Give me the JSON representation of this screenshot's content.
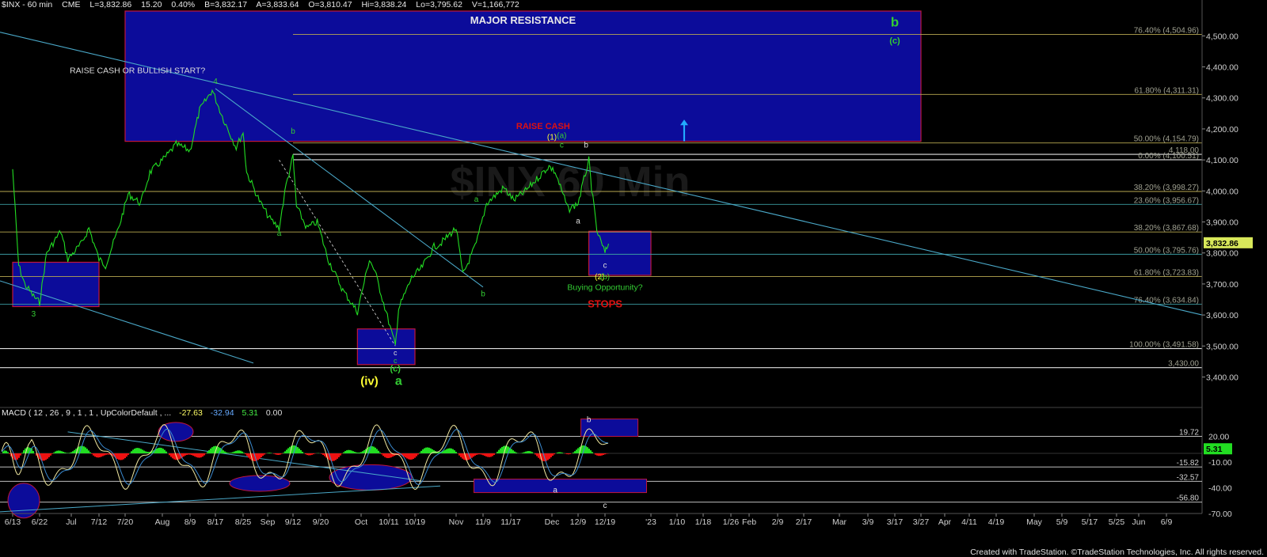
{
  "header": {
    "symbol": "$INX - 60 min",
    "exchange": "CME",
    "last": "L=3,832.86",
    "change": "15.20",
    "change_pct": "0.40%",
    "bid": "B=3,832.17",
    "ask": "A=3,833.64",
    "open": "O=3,810.47",
    "high": "Hi=3,838.24",
    "low": "Lo=3,795.62",
    "volume": "V=1,166,772"
  },
  "watermark": "$INX 60 Min",
  "colors": {
    "background": "#000000",
    "price_line": "#22dd22",
    "zone_fill": "#0c0c9a",
    "zone_border": "#c0163c",
    "trendline": "#4aa8c8",
    "fib_line": "#b8a850",
    "label_green": "#33cc33",
    "label_red": "#dd1111",
    "label_yellow": "#ffff33",
    "last_price_tag": "#d8e85a",
    "macd_up": "#22dd22",
    "macd_down": "#ee1111",
    "macd_signal": "#f0e8a0"
  },
  "chart_data": {
    "type": "line",
    "title": "",
    "y_axis": {
      "ylim": [
        3340,
        4580
      ],
      "tick_labels": [
        "4,500.00",
        "4,400.00",
        "4,300.00",
        "4,200.00",
        "4,100.00",
        "4,000.00",
        "3,900.00",
        "3,800.00",
        "3,700.00",
        "3,600.00",
        "3,500.00",
        "3,400.00"
      ],
      "tick_values": [
        4500,
        4400,
        4300,
        4200,
        4100,
        4000,
        3900,
        3800,
        3700,
        3600,
        3500,
        3400
      ]
    },
    "x_axis": {
      "tick_labels": [
        "6/13",
        "6/22",
        "Jul",
        "7/12",
        "7/20",
        "Aug",
        "8/9",
        "8/17",
        "8/25",
        "Sep",
        "9/12",
        "9/20",
        "Oct",
        "10/11",
        "10/19",
        "Nov",
        "11/9",
        "11/17",
        "Dec",
        "12/9",
        "12/19",
        "'23",
        "1/10",
        "1/18",
        "1/26",
        "Feb",
        "2/9",
        "2/17",
        "Mar",
        "3/9",
        "3/17",
        "3/27",
        "Apr",
        "4/11",
        "4/19",
        "May",
        "5/9",
        "5/17",
        "5/25",
        "Jun",
        "6/9"
      ]
    },
    "series": [
      {
        "name": "",
        "points": [
          [
            "6/13",
            4070
          ],
          [
            "6/15",
            3760
          ],
          [
            "6/17",
            3700
          ],
          [
            "6/20",
            3660
          ],
          [
            "6/22",
            3640
          ],
          [
            "6/24",
            3800
          ],
          [
            "6/28",
            3870
          ],
          [
            "6/30",
            3780
          ],
          [
            "7/5",
            3830
          ],
          [
            "7/8",
            3880
          ],
          [
            "7/12",
            3780
          ],
          [
            "7/14",
            3760
          ],
          [
            "7/18",
            3880
          ],
          [
            "7/21",
            3990
          ],
          [
            "7/25",
            3960
          ],
          [
            "7/28",
            4060
          ],
          [
            "8/2",
            4110
          ],
          [
            "8/5",
            4150
          ],
          [
            "8/9",
            4130
          ],
          [
            "8/12",
            4260
          ],
          [
            "8/16",
            4325
          ],
          [
            "8/19",
            4240
          ],
          [
            "8/23",
            4140
          ],
          [
            "8/25",
            4190
          ],
          [
            "8/26",
            4060
          ],
          [
            "8/30",
            3960
          ],
          [
            "9/2",
            3910
          ],
          [
            "9/6",
            3880
          ],
          [
            "9/9",
            4020
          ],
          [
            "9/12",
            4110
          ],
          [
            "9/13",
            3950
          ],
          [
            "9/16",
            3880
          ],
          [
            "9/19",
            3900
          ],
          [
            "9/22",
            3780
          ],
          [
            "9/26",
            3680
          ],
          [
            "9/30",
            3610
          ],
          [
            "10/4",
            3780
          ],
          [
            "10/6",
            3740
          ],
          [
            "10/10",
            3610
          ],
          [
            "10/13",
            3500
          ],
          [
            "10/14",
            3620
          ],
          [
            "10/18",
            3720
          ],
          [
            "10/21",
            3750
          ],
          [
            "10/25",
            3820
          ],
          [
            "10/27",
            3830
          ],
          [
            "11/1",
            3880
          ],
          [
            "11/3",
            3730
          ],
          [
            "11/7",
            3830
          ],
          [
            "11/10",
            3960
          ],
          [
            "11/15",
            4010
          ],
          [
            "11/18",
            3970
          ],
          [
            "11/22",
            4000
          ],
          [
            "11/25",
            4030
          ],
          [
            "11/30",
            4080
          ],
          [
            "12/2",
            4060
          ],
          [
            "12/6",
            3940
          ],
          [
            "12/9",
            3960
          ],
          [
            "12/13",
            4100
          ],
          [
            "12/14",
            4010
          ],
          [
            "12/16",
            3870
          ],
          [
            "12/19",
            3800
          ],
          [
            "12/20",
            3830
          ]
        ]
      }
    ],
    "last_price": 3832.86,
    "fib_levels": [
      {
        "label": "76.40% (4,504.96)",
        "value": 4504.96
      },
      {
        "label": "61.80% (4,311.31)",
        "value": 4311.31
      },
      {
        "label": "50.00% (4,154.79)",
        "value": 4154.79
      },
      {
        "label": "4,118.00",
        "value": 4118.0
      },
      {
        "label": "0.00% (4,100.51)",
        "value": 4100.51
      },
      {
        "label": "38.20% (3,998.27)",
        "value": 3998.27
      },
      {
        "label": "23.60% (3,956.67)",
        "value": 3956.67
      },
      {
        "label": "38.20% (3,867.68)",
        "value": 3867.68
      },
      {
        "label": "50.00% (3,795.76)",
        "value": 3795.76
      },
      {
        "label": "61.80% (3,723.83)",
        "value": 3723.83
      },
      {
        "label": "76.40% (3,634.84)",
        "value": 3634.84
      },
      {
        "label": "100.00% (3,491.58)",
        "value": 3491.58
      },
      {
        "label": "3,430.00",
        "value": 3430.0
      }
    ],
    "zones": [
      {
        "name": "major-resistance-zone",
        "x0": "7/20",
        "x1": "3/27",
        "y0": 4160,
        "y1": 4580,
        "label": "MAJOR RESISTANCE"
      },
      {
        "name": "june-support-zone",
        "x0": "6/13",
        "x1": "7/12",
        "y0": 3627,
        "y1": 3770
      },
      {
        "name": "october-low-zone",
        "x0": "9/30",
        "x1": "10/19",
        "y0": 3440,
        "y1": 3555
      },
      {
        "name": "buying-opportunity-zone",
        "x0": "12/13",
        "x1": "'23",
        "y0": 3728,
        "y1": 3870
      }
    ],
    "annotations": [
      {
        "text": "RAISE CASH OR BULLISH START?",
        "x": "7/24",
        "y": 4380,
        "color": "#dddddd",
        "size": 10.5
      },
      {
        "text": "4",
        "x": "8/17",
        "y": 4345,
        "color": "#33cc33",
        "size": 10
      },
      {
        "text": "3",
        "x": "6/20",
        "y": 3595,
        "color": "#33cc33",
        "size": 10
      },
      {
        "text": "b",
        "x": "9/12",
        "y": 4185,
        "color": "#33cc33",
        "size": 10
      },
      {
        "text": "a",
        "x": "9/6",
        "y": 3855,
        "color": "#33cc33",
        "size": 10
      },
      {
        "text": "b",
        "x": "11/9",
        "y": 3660,
        "color": "#33cc33",
        "size": 10
      },
      {
        "text": "a",
        "x": "11/7",
        "y": 3965,
        "color": "#33cc33",
        "size": 10
      },
      {
        "text": "RAISE CASH",
        "x": "11/28",
        "y": 4200,
        "color": "#dd1111",
        "size": 11
      },
      {
        "text": "(1)",
        "x": "12/1",
        "y": 4165,
        "color": "#ffff33",
        "size": 10
      },
      {
        "text": "(a)",
        "x": "12/4",
        "y": 4170,
        "color": "#33cc33",
        "size": 10
      },
      {
        "text": "c",
        "x": "12/4",
        "y": 4140,
        "color": "#33cc33",
        "size": 10
      },
      {
        "text": "b",
        "x": "12/12",
        "y": 4140,
        "color": "#dddddd",
        "size": 10
      },
      {
        "text": "a",
        "x": "12/9",
        "y": 3895,
        "color": "#dddddd",
        "size": 10
      },
      {
        "text": "c",
        "x": "12/19",
        "y": 3752,
        "color": "#dddddd",
        "size": 10
      },
      {
        "text": "(2)",
        "x": "12/17",
        "y": 3715,
        "color": "#ffff33",
        "size": 10
      },
      {
        "text": "(b)",
        "x": "12/19",
        "y": 3715,
        "color": "#33cc33",
        "size": 10
      },
      {
        "text": "Buying Opportunity?",
        "x": "12/19",
        "y": 3680,
        "color": "#33cc33",
        "size": 10.5
      },
      {
        "text": "STOPS",
        "x": "12/19",
        "y": 3625,
        "color": "#dd1111",
        "size": 13
      },
      {
        "text": "c",
        "x": "10/13",
        "y": 3470,
        "color": "#dddddd",
        "size": 9
      },
      {
        "text": "c",
        "x": "10/13",
        "y": 3445,
        "color": "#33cc33",
        "size": 9
      },
      {
        "text": "(c)",
        "x": "10/13",
        "y": 3418,
        "color": "#33cc33",
        "size": 11
      },
      {
        "text": "(iv)",
        "x": "10/4",
        "y": 3375,
        "color": "#ffff33",
        "size": 15
      },
      {
        "text": "a",
        "x": "10/14",
        "y": 3375,
        "color": "#33cc33",
        "size": 16
      },
      {
        "text": "b",
        "x": "3/17",
        "y": 4530,
        "color": "#33cc33",
        "size": 17
      },
      {
        "text": "(c)",
        "x": "3/17",
        "y": 4475,
        "color": "#33cc33",
        "size": 11
      }
    ]
  },
  "macd": {
    "label": "MACD ( 12 , 26 , 9 , 1 , 1 , UpColorDefault , ...",
    "value1": "-27.63",
    "value2": "-32.94",
    "value3": "5.31",
    "value4": "0.00",
    "y_tick_labels": [
      "20.00",
      "-10.00",
      "-40.00",
      "-70.00"
    ],
    "y_tick_values": [
      20,
      -10,
      -40,
      -70
    ],
    "levels": [
      {
        "label": "19.72",
        "value": 19.72
      },
      {
        "label": "-15.82",
        "value": -15.82
      },
      {
        "label": "-32.57",
        "value": -32.57
      },
      {
        "label": "-56.80",
        "value": -56.8
      }
    ],
    "current_value_label": "5.31",
    "annotations": [
      {
        "text": "b",
        "x": "12/13",
        "y": 40
      },
      {
        "text": "a",
        "x": "12/2",
        "y": -42
      },
      {
        "text": "c",
        "x": "12/19",
        "y": -60
      }
    ]
  },
  "footer": "Created with TradeStation. ©TradeStation Technologies, Inc. All rights reserved."
}
